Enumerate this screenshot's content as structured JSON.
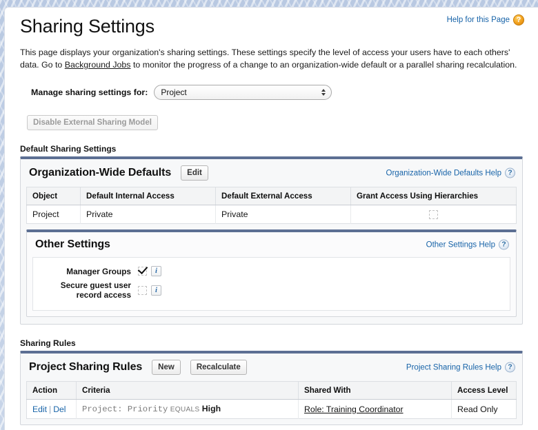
{
  "page": {
    "title": "Sharing Settings",
    "help_link": "Help for this Page",
    "help_icon": "help-circle-orange-icon",
    "intro_part1": "This page displays your organization's sharing settings. These settings specify the level of access your users have to each others' data. Go to ",
    "intro_link": "Background Jobs",
    "intro_part2": " to monitor the progress of a change to an organization-wide default or a parallel sharing recalculation."
  },
  "manage": {
    "label": "Manage sharing settings for:",
    "selected": "Project",
    "options": [
      "Project"
    ]
  },
  "external_model": {
    "button_label": "Disable External Sharing Model",
    "disabled": true
  },
  "default_sharing": {
    "section_label": "Default Sharing Settings",
    "owd": {
      "title": "Organization-Wide Defaults",
      "edit_label": "Edit",
      "help_label": "Organization-Wide Defaults Help",
      "help_icon": "help-circle-blue-icon",
      "columns": [
        "Object",
        "Default Internal Access",
        "Default External Access",
        "Grant Access Using Hierarchies"
      ],
      "rows": [
        {
          "object": "Project",
          "internal_access": "Private",
          "external_access": "Private",
          "grant_hierarchies_checked": false
        }
      ]
    },
    "other_settings": {
      "title": "Other Settings",
      "help_label": "Other Settings Help",
      "help_icon": "help-circle-blue-icon",
      "rows": [
        {
          "label": "Manager Groups",
          "checked": true,
          "info_icon": "info-icon"
        },
        {
          "label": "Secure guest user record access",
          "checked": false,
          "info_icon": "info-icon"
        }
      ]
    }
  },
  "sharing_rules": {
    "section_label": "Sharing Rules",
    "title": "Project Sharing Rules",
    "new_label": "New",
    "recalculate_label": "Recalculate",
    "help_label": "Project Sharing Rules Help",
    "help_icon": "help-circle-blue-icon",
    "columns": [
      "Action",
      "Criteria",
      "Shared With",
      "Access Level"
    ],
    "rows": [
      {
        "edit_label": "Edit",
        "separator": "|",
        "del_label": "Del",
        "criteria_field": "Project: Priority",
        "criteria_operator": "EQUALS",
        "criteria_value": "High",
        "shared_with": "Role: Training Coordinator",
        "access_level": "Read Only"
      }
    ]
  },
  "colors": {
    "link_blue": "#1763a8",
    "panel_top_border": "#5c6f93",
    "banner_blue": "#c3d1e6",
    "help_orange": "#f5a623"
  }
}
